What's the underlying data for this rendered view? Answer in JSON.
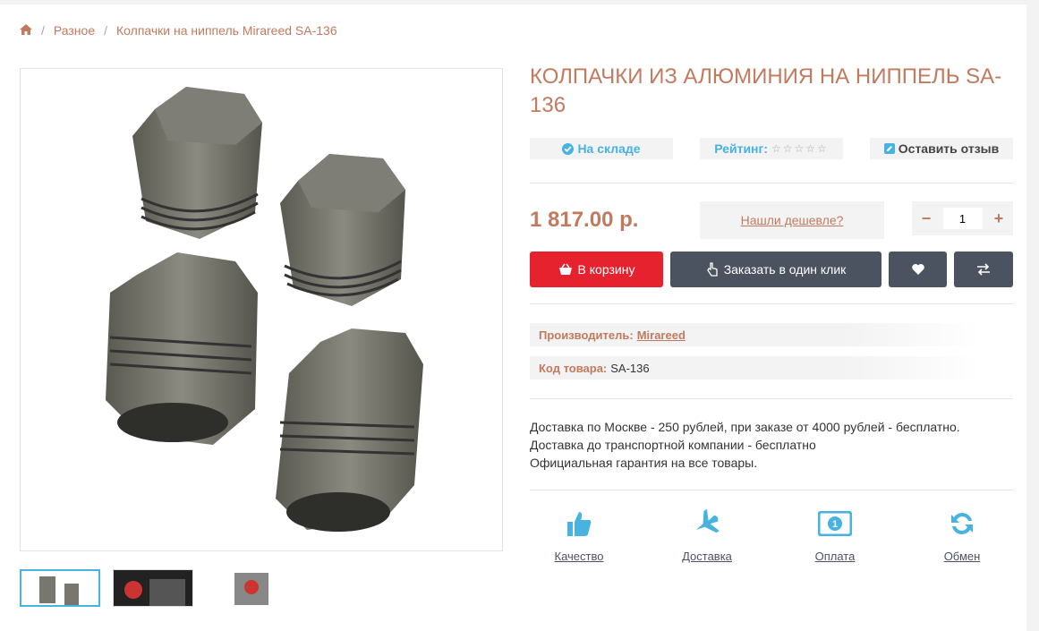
{
  "breadcrumb": {
    "home_icon": "home-icon",
    "items": [
      "Разное",
      "Колпачки на ниппель Mirareed SA-136"
    ]
  },
  "product": {
    "title": "КОЛПАЧКИ ИЗ АЛЮМИНИЯ НА НИППЕЛЬ SA-136",
    "stock": "На складе",
    "rating_label": "Рейтинг:",
    "rating_stars": 0,
    "review": "Оставить отзыв",
    "price": "1 817.00 р.",
    "cheaper": "Нашли дешевле?",
    "qty_minus": "−",
    "qty_value": "1",
    "qty_plus": "+",
    "cart": "В корзину",
    "oneclick": "Заказать в один клик"
  },
  "props": {
    "maker_label": "Производитель:",
    "maker": "Mirareed",
    "code_label": "Код товара:",
    "code": "SA-136"
  },
  "delivery": [
    "Доставка по Москве - 250 рублей, при заказе от 4000 рублей - бесплатно.",
    "Доставка до транспортной компании - бесплатно",
    "Официальная гарантия на все товары."
  ],
  "features": [
    "Качество",
    "Доставка",
    "Оплата",
    "Обмен"
  ],
  "colors": {
    "accent": "#c27a5e",
    "blue": "#48b2e0",
    "red": "#e5222d",
    "dark": "#4b5361"
  }
}
